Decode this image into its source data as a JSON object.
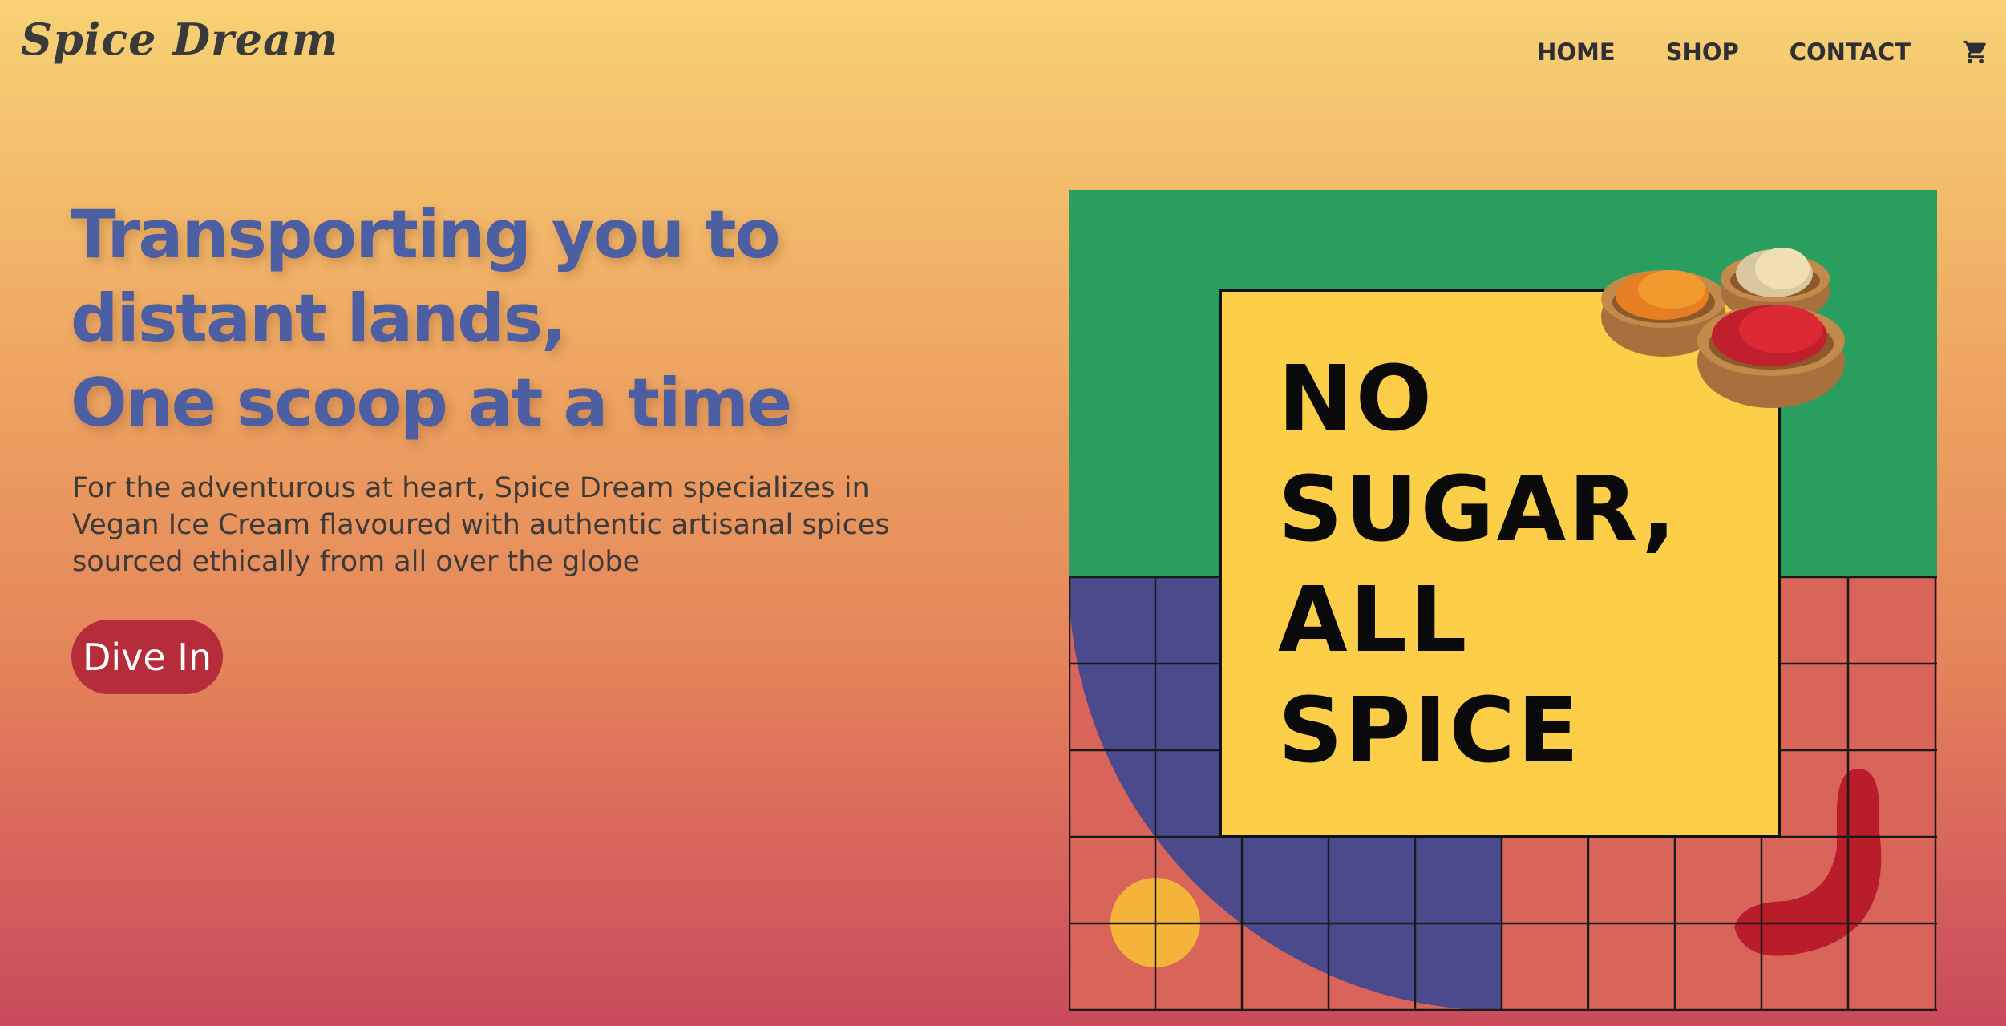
{
  "brand": {
    "name": "Spice Dream"
  },
  "nav": {
    "items": [
      "HOME",
      "SHOP",
      "CONTACT"
    ],
    "cart_icon": "shopping-cart-icon"
  },
  "hero": {
    "headline_lines": [
      "Transporting you to",
      "distant lands,",
      "One scoop at a time"
    ],
    "description_lines": [
      "For the adventurous at heart, Spice Dream specializes in",
      "Vegan Ice Cream flavoured with authentic artisanal spices",
      "sourced ethically from all over the globe"
    ],
    "cta_label": "Dive In"
  },
  "poster": {
    "slogan_lines": [
      "NO",
      "SUGAR,",
      "ALL",
      "SPICE"
    ]
  },
  "colors": {
    "background_top": "#f7d274",
    "background_bottom": "#c94a5b",
    "headline": "#4b5fa2",
    "cta": "#b52c3b",
    "poster_green": "#2a9e5e",
    "poster_grid": "#d9655a",
    "poster_navy": "#4a4a8c",
    "poster_card": "#fdcf48"
  }
}
